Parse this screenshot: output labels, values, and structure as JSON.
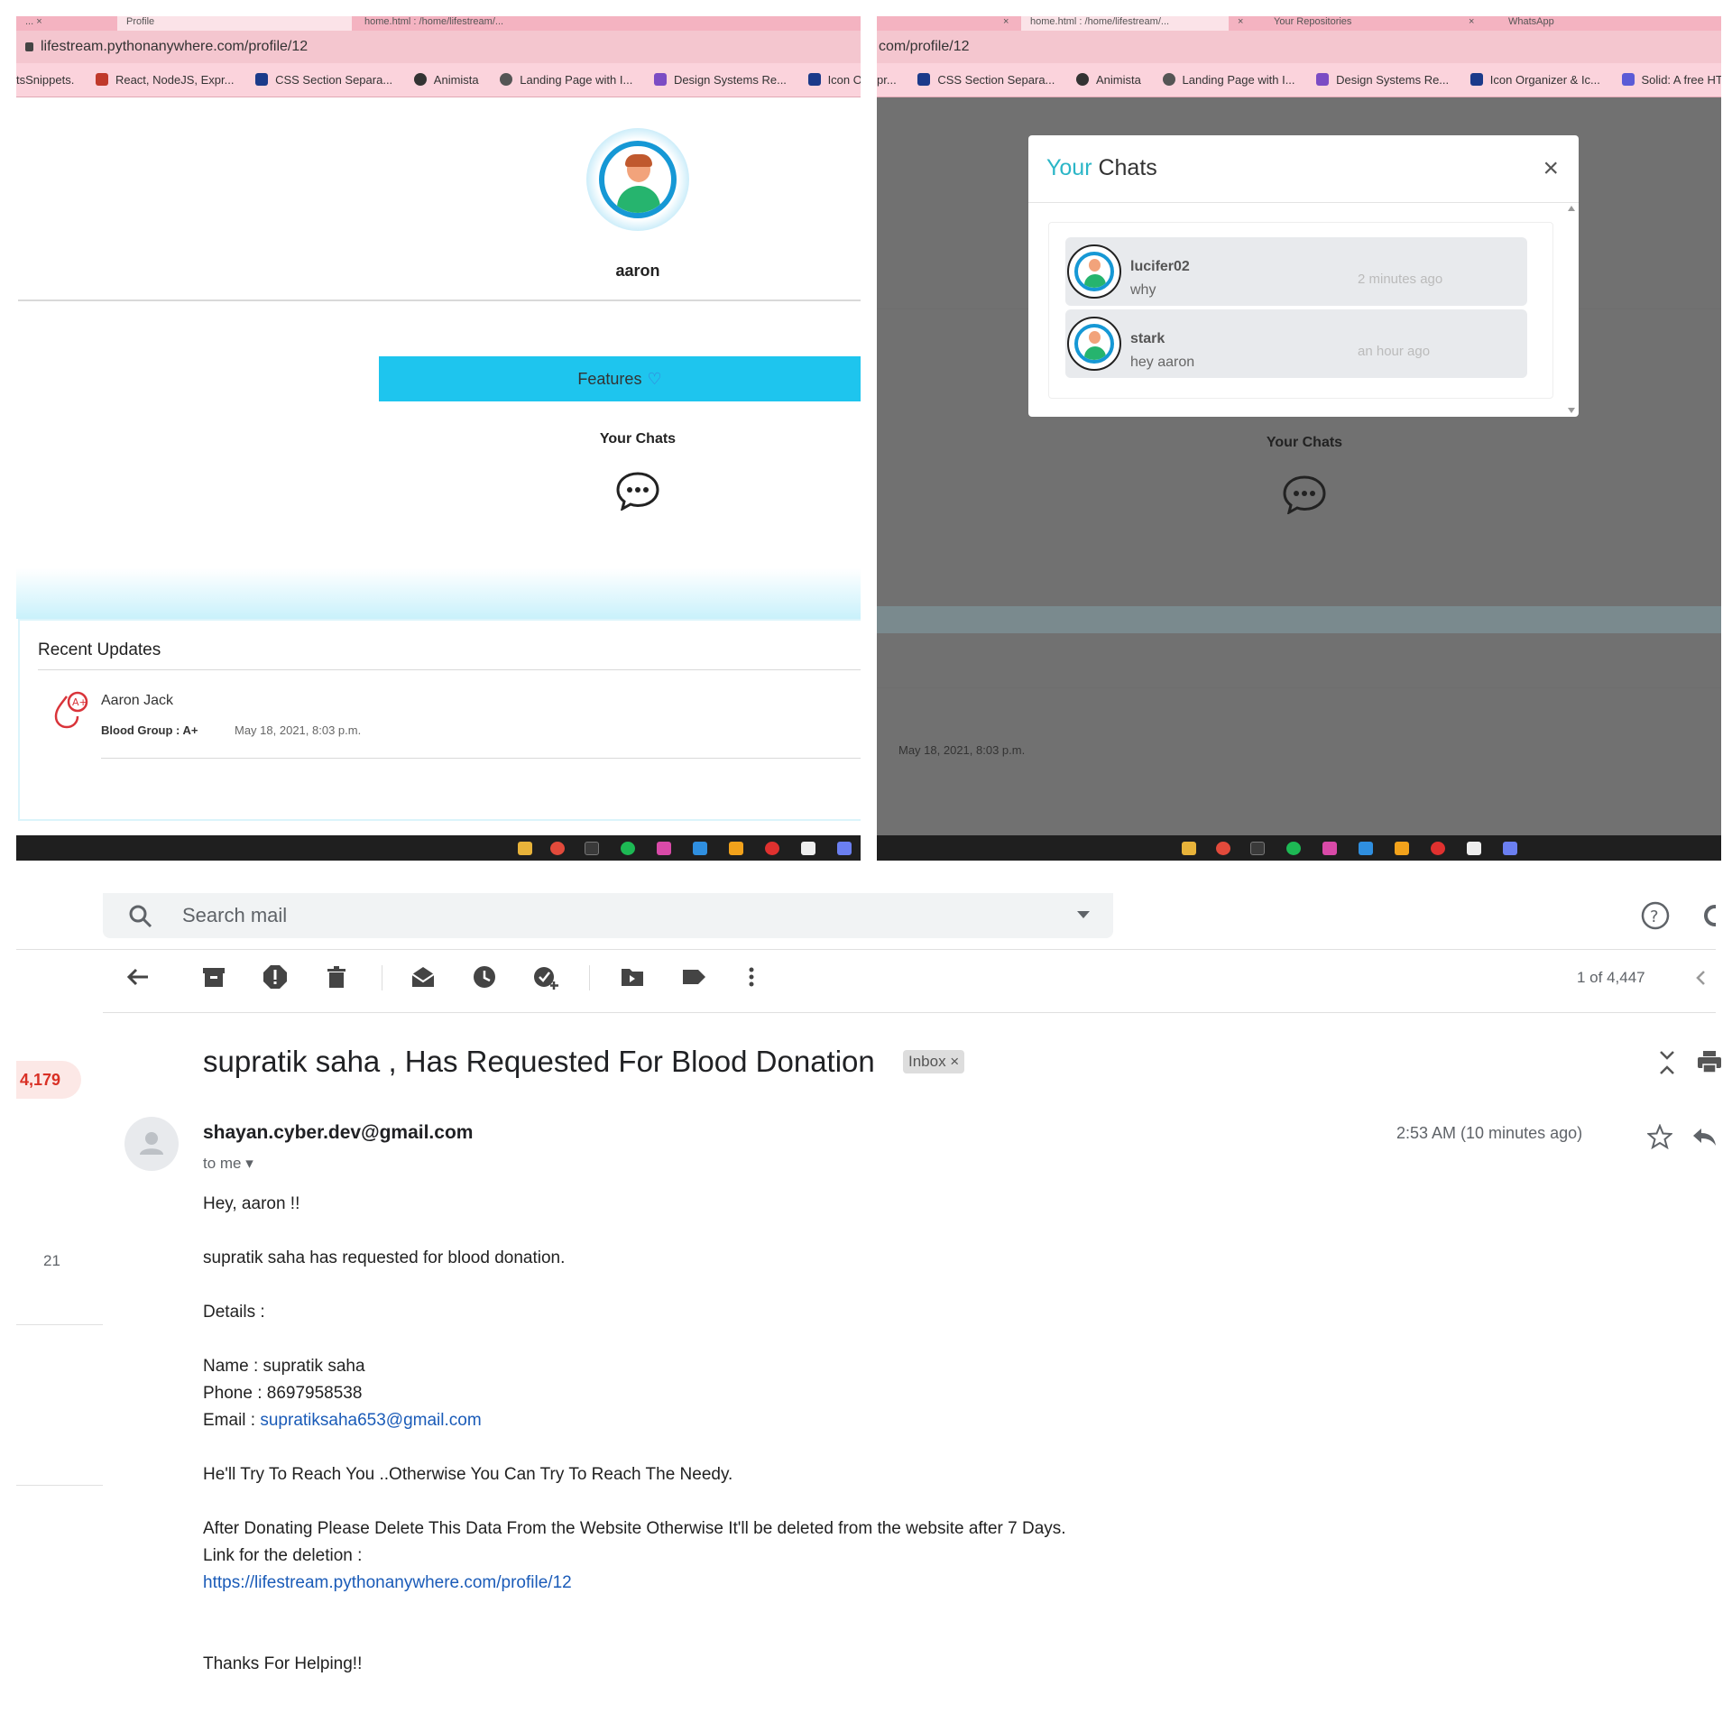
{
  "left_browser": {
    "tabs": [
      "... ×",
      "Profile",
      "home.html : /home/lifestream/..."
    ],
    "url": "lifestream.pythonanywhere.com/profile/12",
    "bookmarks": [
      "tsSnippets.",
      "React, NodeJS, Expr...",
      "CSS Section Separa...",
      "Animista",
      "Landing Page with I...",
      "Design Systems Re...",
      "Icon Orga"
    ],
    "profile": {
      "username": "aaron",
      "features_label": "Features",
      "chats_title": "Your Chats"
    },
    "recent_updates": {
      "title": "Recent Updates",
      "items": [
        {
          "name": "Aaron Jack",
          "blood_group": "Blood Group : A+",
          "date": "May 18, 2021, 8:03 p.m."
        }
      ]
    }
  },
  "right_browser": {
    "tabs": [
      "×",
      "home.html : /home/lifestream/...",
      "×",
      "Your Repositories",
      "×",
      "WhatsApp"
    ],
    "url": "com/profile/12",
    "bookmarks": [
      "pr...",
      "CSS Section Separa...",
      "Animista",
      "Landing Page with I...",
      "Design Systems Re...",
      "Icon Organizer & Ic...",
      "Solid: A free HTM"
    ],
    "modal": {
      "title_accent": "Your",
      "title_rest": " Chats",
      "close_glyph": "×",
      "chats": [
        {
          "name": "lucifer02",
          "message": "why",
          "time": "2 minutes ago"
        },
        {
          "name": "stark",
          "message": "hey aaron",
          "time": "an hour ago"
        }
      ]
    },
    "chats_title": "Your Chats",
    "update_date": "May 18, 2021, 8:03 p.m."
  },
  "gmail": {
    "search_placeholder": "Search mail",
    "pager": "1 of 4,447",
    "unread_count": "4,179",
    "side_count": "21",
    "subject": "supratik saha , Has Requested For Blood Donation",
    "label_chip": "Inbox ×",
    "sender": "shayan.cyber.dev@gmail.com",
    "to": "to me",
    "time": "2:53 AM (10 minutes ago)",
    "body": {
      "greeting": "Hey, aaron !!",
      "line1": "supratik saha has requested for blood donation.",
      "details": "Details :",
      "name": "Name : supratik saha",
      "phone": "Phone : 8697958538",
      "email_label": "Email : ",
      "email": "supratiksaha653@gmail.com",
      "reach": "He'll Try To Reach You ..Otherwise You Can Try To Reach The Needy.",
      "after": "After Donating Please Delete This Data From the Website Otherwise It'll be deleted from the website after 7 Days.",
      "link_label": "Link for the deletion :",
      "link": "https://lifestream.pythonanywhere.com/profile/12",
      "thanks": "Thanks For Helping!!"
    }
  },
  "colors": {
    "tab_strip": "#f4b3c1",
    "features_button": "#1ec5ee",
    "modal_accent": "#2bb6c7",
    "gmail_badge": "#d93025",
    "link": "#1a5bb8"
  }
}
